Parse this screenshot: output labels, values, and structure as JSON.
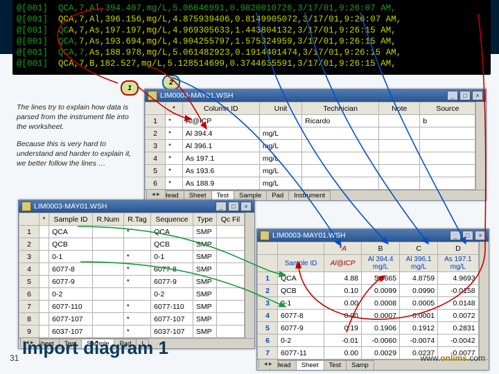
{
  "terminal": {
    "lines": [
      {
        "pre": "@[001]  QCA,7,Al,394.407,mg/L,5.06646991,0.9820010726,3/17/01,9:26:07 AM,",
        "hl": ""
      },
      {
        "pre": "@[001]  ",
        "hl": "QCA,7,Al,396.156,mg/L,4.875939406,0.8149905072,3/17/01,9:26:07 AM,"
      },
      {
        "pre": "@[001]  QC",
        "hl": "A,7,As,197.197,mg/L,4.969305633,1.443804132,3/17/01,9:26:15 AM,"
      },
      {
        "pre": "@[001]  QCA,",
        "hl": "7,As,193.694,mg/L,4.904255797,1.575324959,3/17/01,9:26:15 AM,"
      },
      {
        "pre": "@[001]  QCA,7,",
        "hl": "As,188.978,mg/L,5.061482923,0.1914401474,3/17/01,9:26:15 AM,"
      },
      {
        "pre": "@[001]  ",
        "hl": "QCA,7,B,182.527,mg/L,5.128514699,0.3744635591,3/17/01,9:26:15 AM,"
      }
    ]
  },
  "caption": {
    "p1": "The lines try to explain how data is parsed from the instrument file into the worksheet.",
    "p2": "Because this is very hard to understand and harder to explain it, we better follow the lines …"
  },
  "badges": {
    "b1": "1",
    "b2": "2"
  },
  "win1": {
    "title": "LIM0003-MAY01.WSH",
    "headers": [
      "*",
      "Column ID",
      "Unit",
      "Technician",
      "Note",
      "Source"
    ],
    "rows": [
      [
        "1",
        "*",
        "Al@ICP",
        "",
        "Ricardo",
        "",
        "b"
      ],
      [
        "2",
        "*",
        "Al 394.4",
        "mg/L",
        "",
        "",
        ""
      ],
      [
        "3",
        "*",
        "Al 396.1",
        "mg/L",
        "",
        "",
        ""
      ],
      [
        "4",
        "*",
        "As 197.1",
        "mg/L",
        "",
        "",
        ""
      ],
      [
        "5",
        "*",
        "As 193.6",
        "mg/L",
        "",
        "",
        ""
      ],
      [
        "6",
        "*",
        "As 188.9",
        "mg/L",
        "",
        "",
        ""
      ]
    ],
    "tabs": [
      "Head",
      "Sheet",
      "Test",
      "Sample",
      "Pad",
      "Instrument"
    ],
    "active": 2
  },
  "win2": {
    "title": "LIM0003-MAY01.WSH",
    "headers": [
      "*",
      "Sample ID",
      "R.Num",
      "R.Tag",
      "Sequence",
      "Type",
      "Qc Fil"
    ],
    "rows": [
      [
        "1",
        "",
        "QCA",
        "",
        "*",
        "QCA",
        "SMP",
        ""
      ],
      [
        "2",
        "",
        "QCB",
        "",
        "",
        "QCB",
        "SMP",
        ""
      ],
      [
        "3",
        "",
        "0-1",
        "",
        "*",
        "0-1",
        "SMP",
        ""
      ],
      [
        "4",
        "",
        "6077-8",
        "",
        "*",
        "6077-8",
        "SMP",
        ""
      ],
      [
        "5",
        "",
        "6077-9",
        "",
        "*",
        "6077-9",
        "SMP",
        ""
      ],
      [
        "6",
        "",
        "0-2",
        "",
        "",
        "0-2",
        "SMP",
        ""
      ],
      [
        "7",
        "",
        "6077-110",
        "",
        "*",
        "6077-110",
        "SMP",
        ""
      ],
      [
        "8",
        "",
        "6077-107",
        "",
        "*",
        "6077-107",
        "SMP",
        ""
      ],
      [
        "9",
        "",
        "6037-107",
        "",
        "*",
        "6037-107",
        "SMP",
        ""
      ]
    ],
    "tabs": [
      "Sheet",
      "Test",
      "Sample",
      "Pad",
      "I"
    ],
    "active": 2
  },
  "win3": {
    "title": "LIM0003-MAY01.WSH",
    "top": [
      "",
      "*A",
      "B",
      "C",
      "D"
    ],
    "sub": [
      "Sample ID",
      "Al@ICP",
      "Al 394.4\nmg/L",
      "Al 396.1\nmg/L",
      "As 197.1\nmg/L"
    ],
    "rows": [
      [
        "1",
        "QCA",
        "4.88",
        "5.0665",
        "4.8759",
        "4.9693"
      ],
      [
        "2",
        "QCB",
        "0.10",
        "0.0099",
        "0.0990",
        "-0.0158"
      ],
      [
        "3",
        "0-1",
        "0.00",
        "0.0008",
        "0.0005",
        "0.0148"
      ],
      [
        "4",
        "6077-8",
        "0.00",
        "0.0007",
        "0.0001",
        "0.0072"
      ],
      [
        "5",
        "6077-9",
        "0.19",
        "0.1906",
        "0.1912",
        "0.2831"
      ],
      [
        "6",
        "0-2",
        "-0.01",
        "-0.0060",
        "-0.0074",
        "-0.0042"
      ],
      [
        "7",
        "6077-11",
        "0.00",
        "0.0029",
        "0.0237",
        "-0.0077"
      ]
    ],
    "tabs": [
      "Head",
      "Sheet",
      "Test",
      "Samp"
    ],
    "active": 1
  },
  "footer": {
    "title": "Import diagram 1",
    "page": "31",
    "url_pre": "www.",
    "url_bold": "onlims",
    "url_post": ".com"
  },
  "ctrl": {
    "min": "_",
    "max": "□",
    "close": "×"
  }
}
